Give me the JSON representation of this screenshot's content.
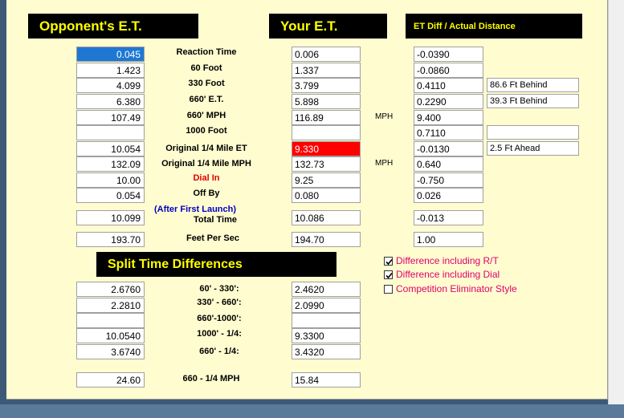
{
  "headers": {
    "opponent": "Opponent's E.T.",
    "yours": "Your E.T.",
    "diff": "ET Diff / Actual Distance",
    "split": "Split Time Differences"
  },
  "rows": [
    {
      "label": "Reaction Time",
      "opp": "0.045",
      "your": "0.006",
      "diff": "-0.0390",
      "dist": null
    },
    {
      "label": "60 Foot",
      "opp": "1.423",
      "your": "1.337",
      "diff": "-0.0860",
      "dist": null
    },
    {
      "label": "330 Foot",
      "opp": "4.099",
      "your": "3.799",
      "diff": "0.4110",
      "dist": "86.6 Ft Behind"
    },
    {
      "label": "660' E.T.",
      "opp": "6.380",
      "your": "5.898",
      "diff": "0.2290",
      "dist": "39.3 Ft Behind"
    },
    {
      "label": "660' MPH",
      "opp": "107.49",
      "your": "116.89",
      "diff": "9.400",
      "dist": null
    },
    {
      "label": "1000 Foot",
      "opp": "",
      "your": "",
      "diff": "0.7110",
      "dist": ""
    },
    {
      "label": "Original 1/4 Mile ET",
      "opp": "10.054",
      "your": "9.330",
      "diff": "-0.0130",
      "dist": "2.5 Ft Ahead"
    },
    {
      "label": "Original 1/4 Mile MPH",
      "opp": "132.09",
      "your": "132.73",
      "diff": "0.640",
      "dist": null
    },
    {
      "label": "Dial In",
      "opp": "10.00",
      "your": "9.25",
      "diff": "-0.750",
      "dist": null
    },
    {
      "label": "Off By",
      "opp": "0.054",
      "your": "0.080",
      "diff": "0.026",
      "dist": null
    }
  ],
  "after_first_launch": "(After First Launch)",
  "total": {
    "label": "Total Time",
    "opp": "10.099",
    "your": "10.086",
    "diff": "-0.013"
  },
  "fps": {
    "label": "Feet Per Sec",
    "opp": "193.70",
    "your": "194.70",
    "diff": "1.00"
  },
  "mph_unit": "MPH",
  "splits": [
    {
      "label": "60' - 330':",
      "opp": "2.6760",
      "your": "2.4620"
    },
    {
      "label": "330' - 660':",
      "opp": "2.2810",
      "your": "2.0990"
    },
    {
      "label": "660'-1000':",
      "opp": "",
      "your": ""
    },
    {
      "label": "1000' - 1/4:",
      "opp": "10.0540",
      "your": "9.3300"
    },
    {
      "label": "660' - 1/4:",
      "opp": "3.6740",
      "your": "3.4320"
    }
  ],
  "mph_660_quarter": {
    "label": "660 - 1/4 MPH",
    "opp": "24.60",
    "your": "15.84"
  },
  "options": [
    {
      "label": "Difference including R/T",
      "checked": true
    },
    {
      "label": "Difference including Dial",
      "checked": true
    },
    {
      "label": "Competition Eliminator Style",
      "checked": false
    }
  ],
  "colors": {
    "panel_bg": "#fffdd0",
    "header_bg": "#000000",
    "header_text": "#ffff00",
    "selected": "#1e78d2",
    "alert": "#ff0000",
    "option_text": "#e0006a"
  }
}
